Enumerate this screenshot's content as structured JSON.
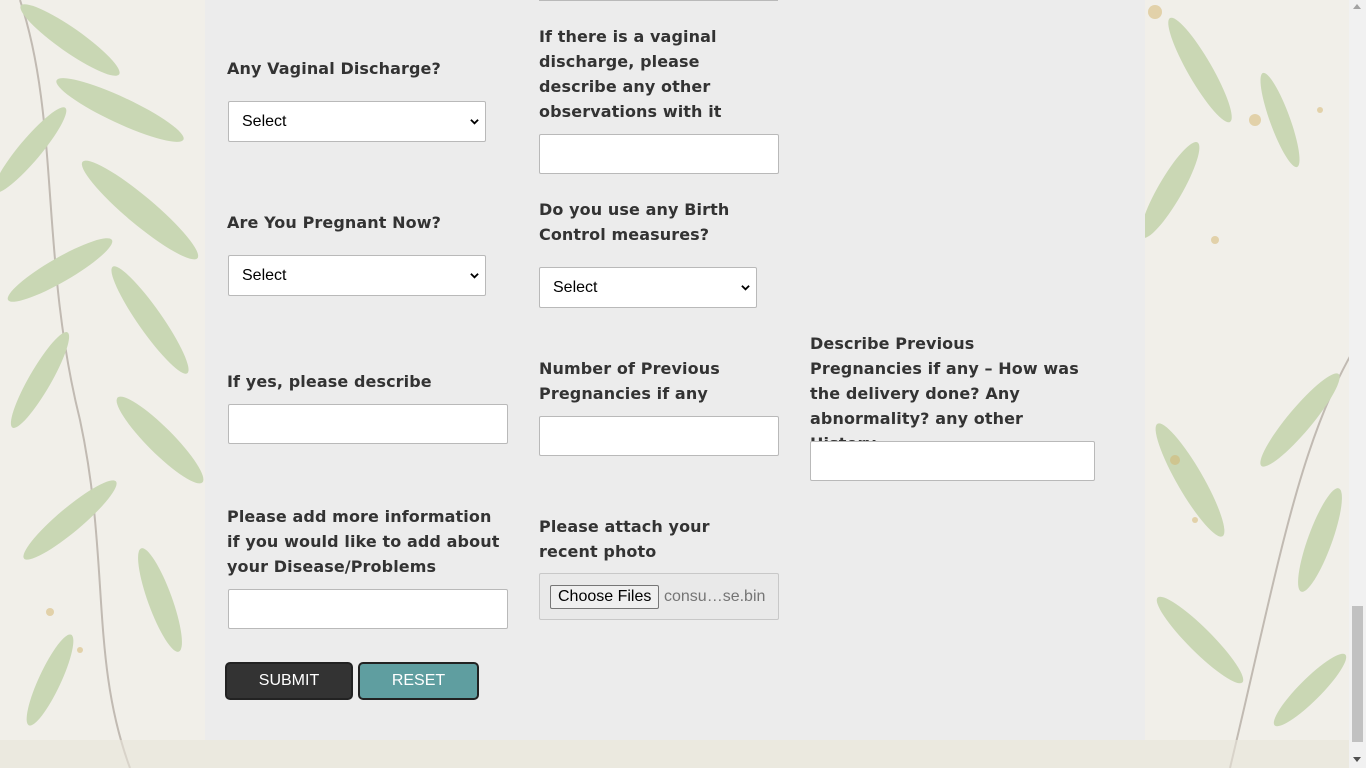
{
  "form": {
    "vaginal_discharge": {
      "label": "Any Vaginal Discharge?",
      "value": "Select"
    },
    "discharge_observations": {
      "label": "If there is a vaginal discharge, please describe any other observations with it",
      "value": ""
    },
    "pregnant_now": {
      "label": "Are You Pregnant Now?",
      "value": "Select"
    },
    "birth_control": {
      "label": "Do you use any Birth Control measures?",
      "value": "Select"
    },
    "if_yes_describe": {
      "label": "If yes, please describe",
      "value": ""
    },
    "previous_pregnancies_count": {
      "label": "Number of Previous Pregnancies if any",
      "value": ""
    },
    "previous_pregnancies_history": {
      "label": "Describe Previous Pregnancies if any – How was the delivery done? Any abnormality? any other History",
      "value": ""
    },
    "more_info": {
      "label": "Please add more information if you would like to add about your Disease/Problems",
      "value": ""
    },
    "photo": {
      "label": "Please attach your recent photo",
      "button": "Choose Files",
      "file_name": "consu…se.bin"
    }
  },
  "actions": {
    "submit": "SUBMIT",
    "reset": "RESET"
  },
  "colors": {
    "panel": "#ececec",
    "submit": "#333333",
    "reset": "#5f9ea0",
    "label": "#333333"
  },
  "icons": {
    "select_arrow": "chevron-down-icon",
    "scroll_up": "scroll-up-arrow-icon",
    "scroll_down": "scroll-down-arrow-icon"
  }
}
